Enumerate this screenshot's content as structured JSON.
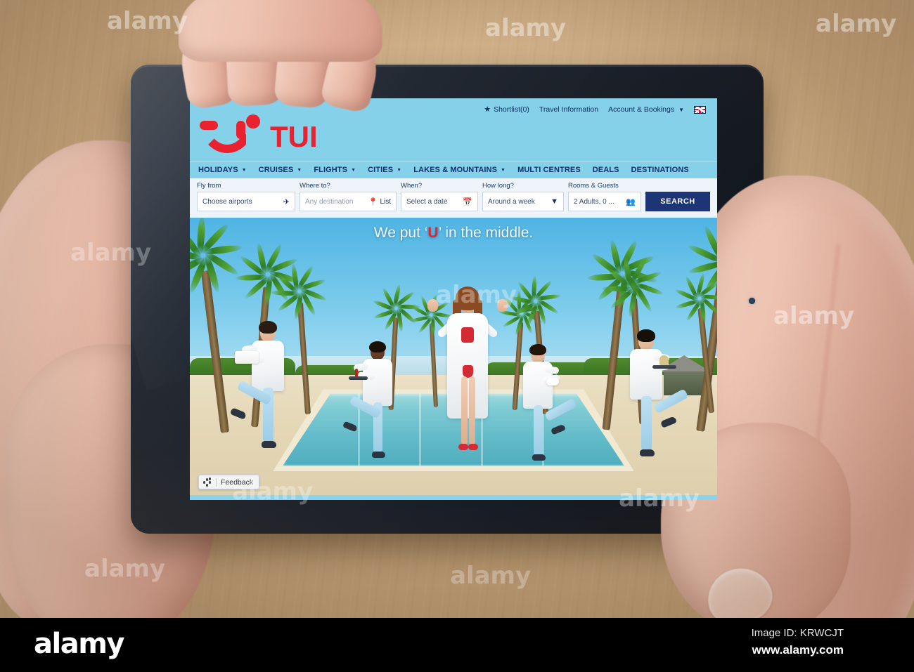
{
  "scene": {
    "description": "Hand holding a tablet displaying the TUI travel website, over a wooden desk",
    "desk_color": "#c9a882",
    "tablet_color": "#1b2029"
  },
  "site": {
    "brand": {
      "name": "TUI",
      "logo_icon": "tui-smile-logo",
      "brand_color": "#e8222e",
      "header_color": "#85d1ea"
    },
    "utility_nav": [
      {
        "label": "Shortlist(0)",
        "icon": "star-icon"
      },
      {
        "label": "Travel Information",
        "icon": ""
      },
      {
        "label": "Account & Bookings",
        "icon": "chevron-down-icon"
      },
      {
        "label": "",
        "icon": "uk-flag-icon"
      }
    ],
    "main_nav": [
      {
        "label": "HOLIDAYS",
        "has_dropdown": true
      },
      {
        "label": "CRUISES",
        "has_dropdown": true
      },
      {
        "label": "FLIGHTS",
        "has_dropdown": true
      },
      {
        "label": "CITIES",
        "has_dropdown": true
      },
      {
        "label": "LAKES & MOUNTAINS",
        "has_dropdown": true
      },
      {
        "label": "MULTI CENTRES",
        "has_dropdown": false
      },
      {
        "label": "DEALS",
        "has_dropdown": false
      },
      {
        "label": "DESTINATIONS",
        "has_dropdown": false
      }
    ],
    "search": {
      "fields": [
        {
          "label": "Fly from",
          "value": "Choose airports",
          "icon": "airplane-icon",
          "icon_text": ""
        },
        {
          "label": "Where to?",
          "value": "Any destination",
          "icon": "map-pin-icon",
          "icon_text": "List"
        },
        {
          "label": "When?",
          "value": "Select a date",
          "icon": "calendar-icon",
          "icon_text": ""
        },
        {
          "label": "How long?",
          "value": "Around a week",
          "icon": "chevron-down-icon",
          "icon_text": ""
        },
        {
          "label": "Rooms & Guests",
          "value": "2 Adults, 0 ...",
          "icon": "guests-icon",
          "icon_text": ""
        }
      ],
      "submit_label": "SEARCH",
      "submit_color": "#1d3576"
    },
    "hero": {
      "tagline_before": "We put ",
      "tagline_quote_open": "‘",
      "tagline_highlight": "U",
      "tagline_quote_close": "’",
      "tagline_after": " in the middle.",
      "highlight_color": "#e8222e"
    },
    "feedback": {
      "label": "Feedback",
      "icon": "dots-icon"
    }
  },
  "watermark": {
    "text": "alamy",
    "bottom_logo": "alamy",
    "image_id": "Image ID: KRWCJT",
    "url": "www.alamy.com"
  }
}
